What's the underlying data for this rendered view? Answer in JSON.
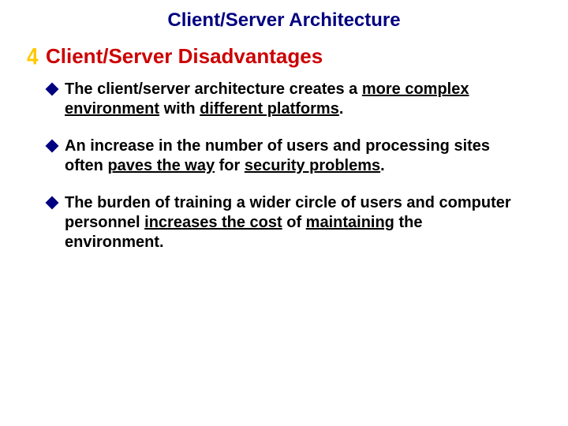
{
  "title": "Client/Server Architecture",
  "section_bullet": "4",
  "section_heading": "Client/Server Disadvantages",
  "items": [
    {
      "t1": "The client/server architecture creates a ",
      "u1": "more complex environment",
      "t2": " with ",
      "u2": "different platforms",
      "t3": "."
    },
    {
      "t1": "An increase in the number of users and processing sites often ",
      "u1": "paves the way",
      "t2": " for ",
      "u2": "security problems",
      "t3": "."
    },
    {
      "t1": "The burden of training a wider circle of users and computer personnel ",
      "u1": "increases the cost",
      "t2": " of ",
      "u2": "maintaining",
      "t3": " the environment."
    }
  ]
}
